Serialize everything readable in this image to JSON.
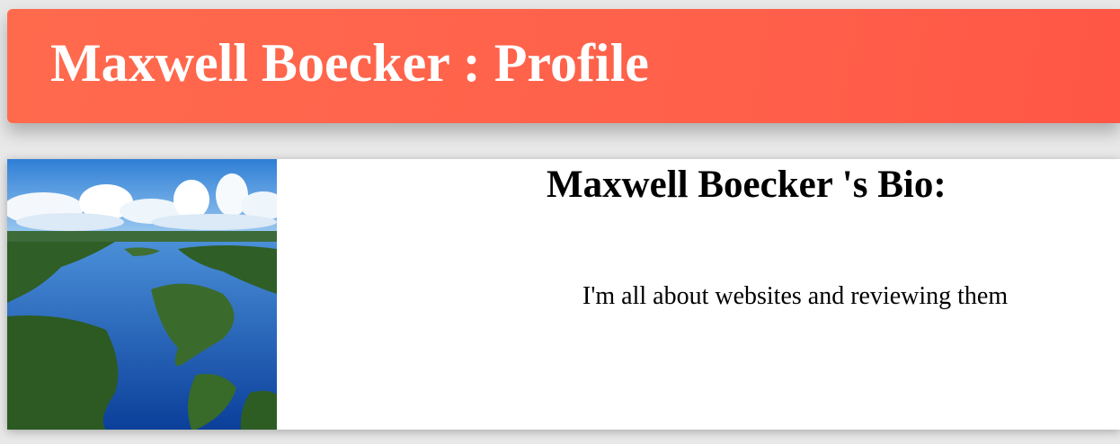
{
  "header": {
    "title": "Maxwell Boecker : Profile"
  },
  "profile": {
    "bio_heading": "Maxwell Boecker 's Bio:",
    "bio_text": "I'm all about websites and reviewing them",
    "image": "lake-landscape-photo"
  },
  "colors": {
    "header_start": "#ff6a4d",
    "header_end": "#ff5646",
    "header_text": "#ffffff",
    "card_bg": "#ffffff",
    "page_bg": "#e8e8e8"
  }
}
